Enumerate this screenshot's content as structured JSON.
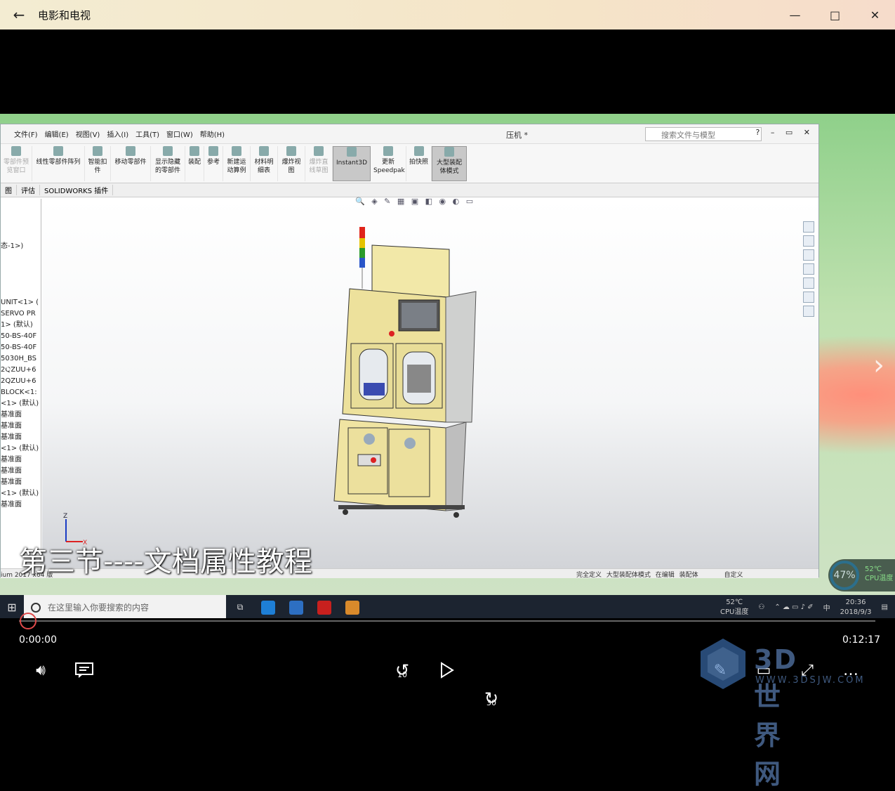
{
  "app": {
    "title": "电影和电视",
    "back_icon": "arrow-left-icon"
  },
  "window_controls": [
    "minimize",
    "maximize",
    "close"
  ],
  "solidworks": {
    "menu": [
      "文件(F)",
      "编辑(E)",
      "视图(V)",
      "插入(I)",
      "工具(T)",
      "窗口(W)",
      "帮助(H)"
    ],
    "document_name": "压机 *",
    "search_placeholder": "搜索文件与模型",
    "ribbon": [
      {
        "label": "零部件预览窗口",
        "dim": true
      },
      {
        "label": "线性零部件阵列"
      },
      {
        "label": "智能扣件"
      },
      {
        "label": "移动零部件"
      },
      {
        "label": "显示隐藏的零部件"
      },
      {
        "label": "装配"
      },
      {
        "label": "参考"
      },
      {
        "label": "新建运动算例"
      },
      {
        "label": "材料明细表"
      },
      {
        "label": "爆炸视图"
      },
      {
        "label": "爆炸直线草图",
        "dim": true
      },
      {
        "label": "Instant3D",
        "selected": true
      },
      {
        "label": "更新Speedpak"
      },
      {
        "label": "拍快照"
      },
      {
        "label": "大型装配体模式",
        "selected": true
      }
    ],
    "tabs": [
      "图",
      "评估",
      "SOLIDWORKS 插件"
    ],
    "tree": [
      "态-1>)",
      "UNIT<1> (",
      "SERVO PR",
      "1> (默认)",
      "50-BS-40F",
      "50-BS-40F",
      "5030H_BS",
      "2QZUU+6",
      "2QZUU+6",
      "BLOCK<1:",
      "<1> (默认)",
      "基准面",
      "基准面",
      "基准面",
      "<1> (默认)",
      "基准面",
      "基准面",
      "基准面",
      "<1> (默认)",
      "基准面"
    ],
    "status_left": "ium 2017 x64 版",
    "status_right": [
      "完全定义",
      "大型装配体模式",
      "在编辑 装配体",
      "自定义"
    ]
  },
  "subtitle": "第三节----文档属性教程",
  "taskbar": {
    "search_placeholder": "在这里输入你要搜索的内容",
    "temp": "52℃",
    "temp_label": "CPU温度",
    "clock_time": "20:36",
    "clock_date": "2018/9/3",
    "ime": "中"
  },
  "cpu_widget": {
    "percent": "47%",
    "temp": "52℃",
    "label": "CPU温度"
  },
  "player": {
    "current": "0:00:00",
    "duration": "0:12:17",
    "progress": 0,
    "skip_back": "10",
    "skip_fwd": "30"
  },
  "watermark": {
    "brand": "3D世界网",
    "url": "WWW.3DSJW.COM"
  }
}
